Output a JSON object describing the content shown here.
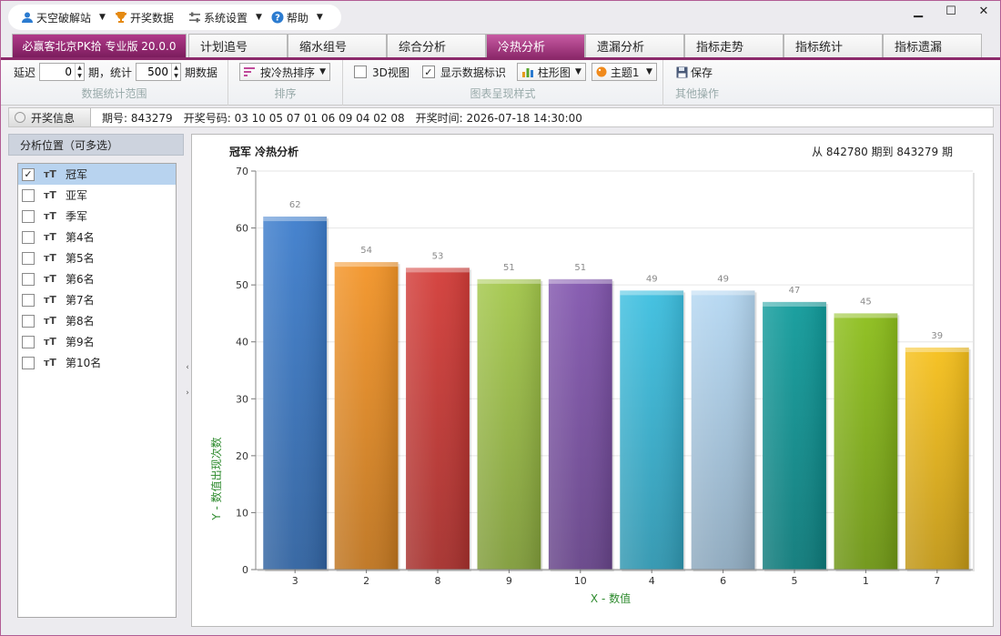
{
  "menu": {
    "items": [
      {
        "label": "天空破解站",
        "icon": "user-icon",
        "has_caret": true
      },
      {
        "label": "开奖数据",
        "icon": "trophy-icon",
        "has_caret": false
      },
      {
        "label": "系统设置",
        "icon": "settings-icon",
        "has_caret": true
      },
      {
        "label": "帮助",
        "icon": "help-icon",
        "has_caret": true
      }
    ]
  },
  "window_controls": {
    "minimize": "▁",
    "maximize": "☐",
    "close": "✕"
  },
  "tabs": {
    "brand": "必赢客北京PK拾 专业版 20.0.0",
    "items": [
      "计划追号",
      "缩水组号",
      "综合分析",
      "冷热分析",
      "遗漏分析",
      "指标走势",
      "指标统计",
      "指标遗漏"
    ],
    "active": "冷热分析"
  },
  "toolbar": {
    "range": {
      "delay_label": "延迟",
      "delay_value": "0",
      "period_sep": "期，统计",
      "count_value": "500",
      "period_suffix": "期数据",
      "caption": "数据统计范围"
    },
    "sort": {
      "value": "按冷热排序",
      "caption": "排序"
    },
    "style": {
      "view3d_label": "3D视图",
      "view3d_checked": false,
      "show_labels_label": "显示数据标识",
      "show_labels_checked": true,
      "chart_type": "柱形图",
      "theme": "主题1",
      "caption": "图表呈现样式"
    },
    "other": {
      "save_label": "保存",
      "caption": "其他操作"
    }
  },
  "info": {
    "button": "开奖信息",
    "period_label": "期号:",
    "period": "843279",
    "numbers_label": "开奖号码:",
    "numbers": "03 10 05 07 01 06 09 04 02 08",
    "time_label": "开奖时间:",
    "time": "2026-07-18 14:30:00"
  },
  "left_panel": {
    "title": "分析位置（可多选）",
    "items": [
      {
        "label": "冠军",
        "checked": true
      },
      {
        "label": "亚军",
        "checked": false
      },
      {
        "label": "季军",
        "checked": false
      },
      {
        "label": "第4名",
        "checked": false
      },
      {
        "label": "第5名",
        "checked": false
      },
      {
        "label": "第6名",
        "checked": false
      },
      {
        "label": "第7名",
        "checked": false
      },
      {
        "label": "第8名",
        "checked": false
      },
      {
        "label": "第9名",
        "checked": false
      },
      {
        "label": "第10名",
        "checked": false
      }
    ]
  },
  "chart_header": {
    "title": "冠军 冷热分析",
    "range": "从 842780 期到 843279 期"
  },
  "chart_data": {
    "type": "bar",
    "title": "冠军 冷热分析",
    "xlabel": "X - 数值",
    "ylabel": "Y - 数值出现次数",
    "categories": [
      "3",
      "2",
      "8",
      "9",
      "10",
      "4",
      "6",
      "5",
      "1",
      "7"
    ],
    "values": [
      62,
      54,
      53,
      51,
      51,
      49,
      49,
      47,
      45,
      39
    ],
    "ylim": [
      0,
      70
    ],
    "yticks": [
      0,
      10,
      20,
      30,
      40,
      50,
      60,
      70
    ],
    "colors": [
      "#3d7dcc",
      "#f39427",
      "#d33c38",
      "#a3c74a",
      "#8256ae",
      "#3cbfe0",
      "#b4d7f2",
      "#109b9b",
      "#8cbe1a",
      "#f6c01b"
    ],
    "grid": true,
    "legend": "none"
  }
}
